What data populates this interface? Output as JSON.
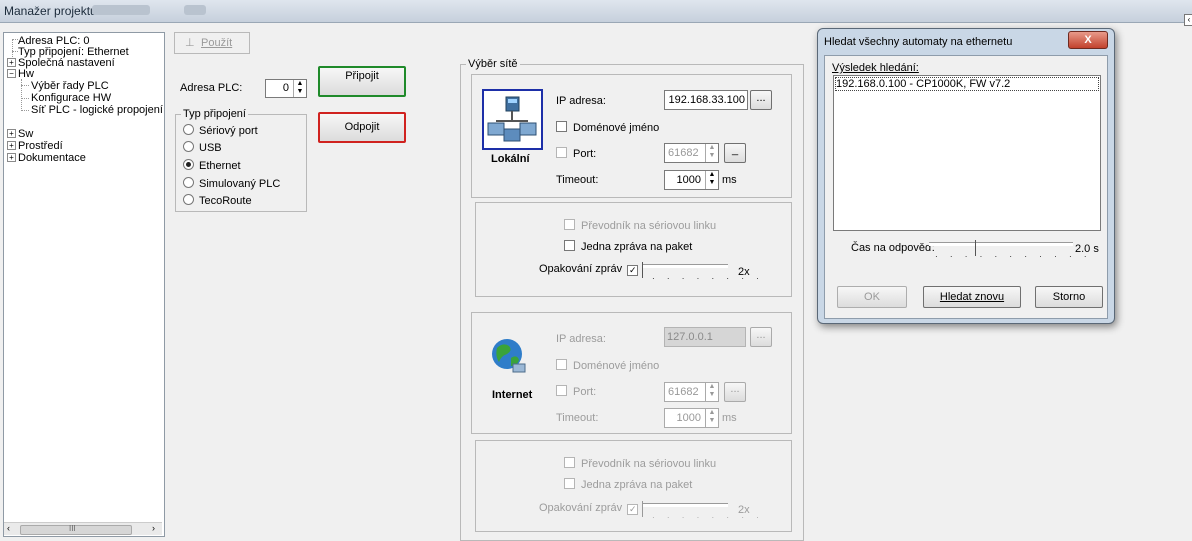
{
  "window": {
    "title": "Manažer projektu"
  },
  "tree": {
    "items": [
      {
        "label": "Adresa PLC: 0",
        "expander": ""
      },
      {
        "label": "Typ připojení: Ethernet",
        "expander": ""
      },
      {
        "label": "Společná nastavení",
        "expander": "+"
      },
      {
        "label": "Hw",
        "expander": "−"
      },
      {
        "label": "Výběr řady PLC",
        "expander": ""
      },
      {
        "label": "Konfigurace HW",
        "expander": ""
      },
      {
        "label": "Síť PLC - logické propojení",
        "expander": ""
      },
      {
        "label": "Sw",
        "expander": "+"
      },
      {
        "label": "Prostředí",
        "expander": "+"
      },
      {
        "label": "Dokumentace",
        "expander": "+"
      }
    ],
    "scroll_label": "III"
  },
  "toolbar": {
    "apply_label": "Použít"
  },
  "plc": {
    "address_label": "Adresa PLC:",
    "address_value": "0",
    "connect_label": "Připojit",
    "disconnect_label": "Odpojit"
  },
  "connection_type": {
    "legend": "Typ připojení",
    "options": [
      "Sériový port",
      "USB",
      "Ethernet",
      "Simulovaný PLC",
      "TecoRoute"
    ],
    "selected": "Ethernet"
  },
  "network": {
    "legend": "Výběr sítě",
    "local": {
      "title": "Lokální",
      "ip_label": "IP adresa:",
      "ip_value": "192.168.33.100",
      "browse_label": "...",
      "domain_label": "Doménové jméno",
      "port_label": "Port:",
      "port_value": "61682",
      "port_btn": "_",
      "timeout_label": "Timeout:",
      "timeout_value": "1000",
      "timeout_unit": "ms",
      "serial_label": "Převodník na sériovou linku",
      "single_msg_label": "Jedna zpráva na paket",
      "repeat_label": "Opakování zpráv",
      "repeat_value": "2x"
    },
    "internet": {
      "title": "Internet",
      "ip_label": "IP adresa:",
      "ip_value": "127.0.0.1",
      "browse_label": "...",
      "domain_label": "Doménové jméno",
      "port_label": "Port:",
      "port_value": "61682",
      "port_btn": "...",
      "timeout_label": "Timeout:",
      "timeout_value": "1000",
      "timeout_unit": "ms",
      "serial_label": "Převodník na sériovou linku",
      "single_msg_label": "Jedna zpráva na paket",
      "repeat_label": "Opakování zpráv",
      "repeat_value": "2x"
    }
  },
  "dialog": {
    "title": "Hledat všechny automaty na ethernetu",
    "close_label": "X",
    "result_label": "Výsledek hledání:",
    "results": [
      "192.168.0.100   - CP1000K, FW v7.2"
    ],
    "response_label": "Čas na odpověď:",
    "response_value": "2.0 s",
    "ok_label": "OK",
    "search_again_label": "Hledat znovu",
    "cancel_label": "Storno"
  },
  "colors": {
    "connect_border": "#1f8a2a",
    "disconnect_border": "#d0221f",
    "highlight": "#1d2fa8"
  }
}
